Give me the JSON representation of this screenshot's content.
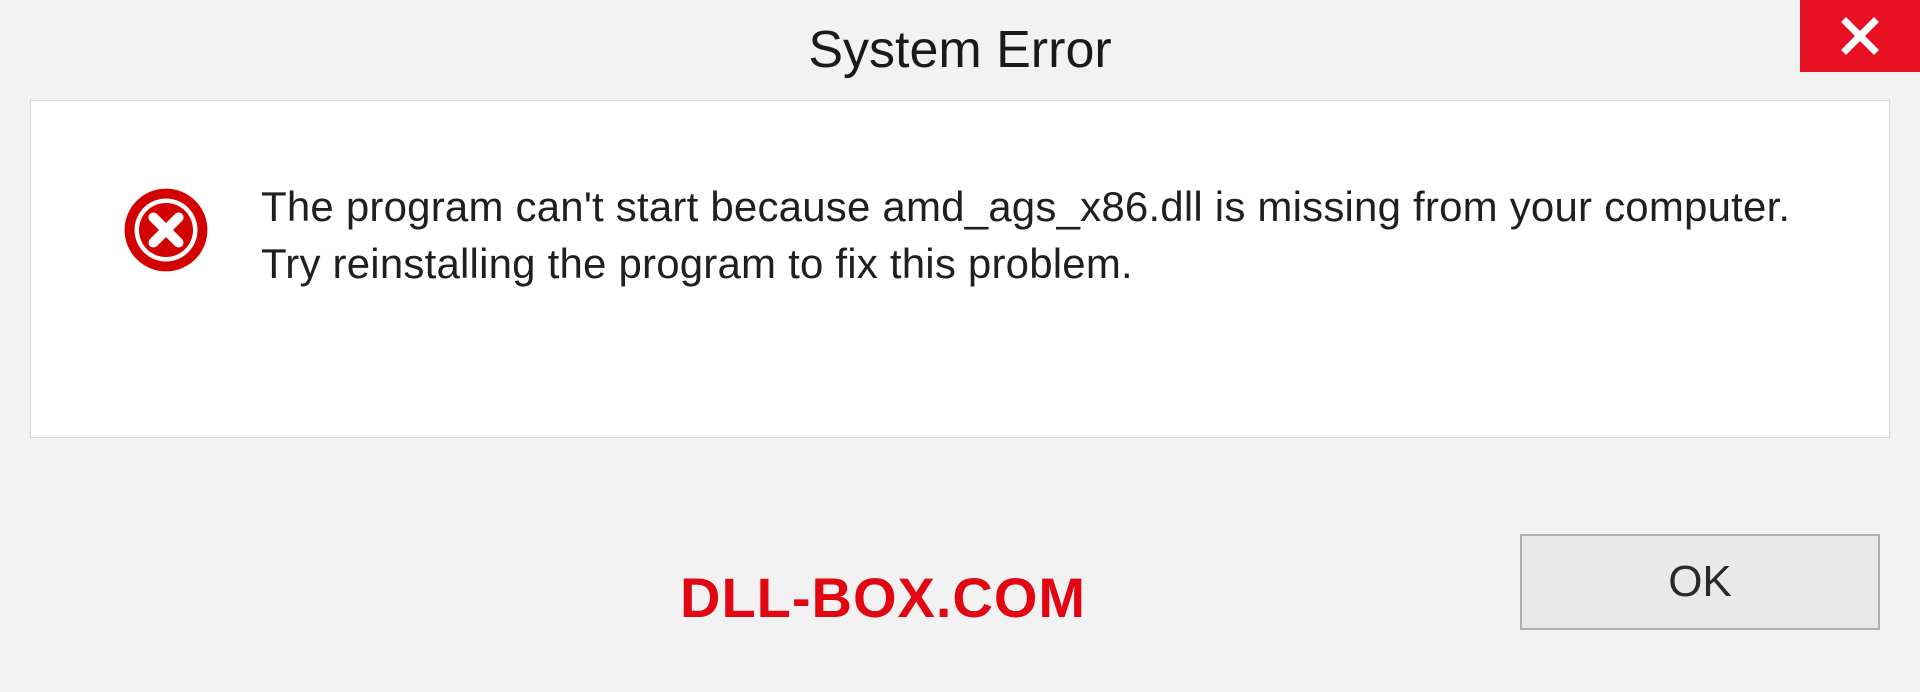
{
  "titlebar": {
    "title": "System Error"
  },
  "content": {
    "message": "The program can't start because amd_ags_x86.dll is missing from your computer. Try reinstalling the program to fix this problem."
  },
  "footer": {
    "watermark": "DLL-BOX.COM",
    "ok_label": "OK"
  },
  "colors": {
    "close_bg": "#e81123",
    "error_icon": "#d30000",
    "watermark": "#e20613"
  }
}
